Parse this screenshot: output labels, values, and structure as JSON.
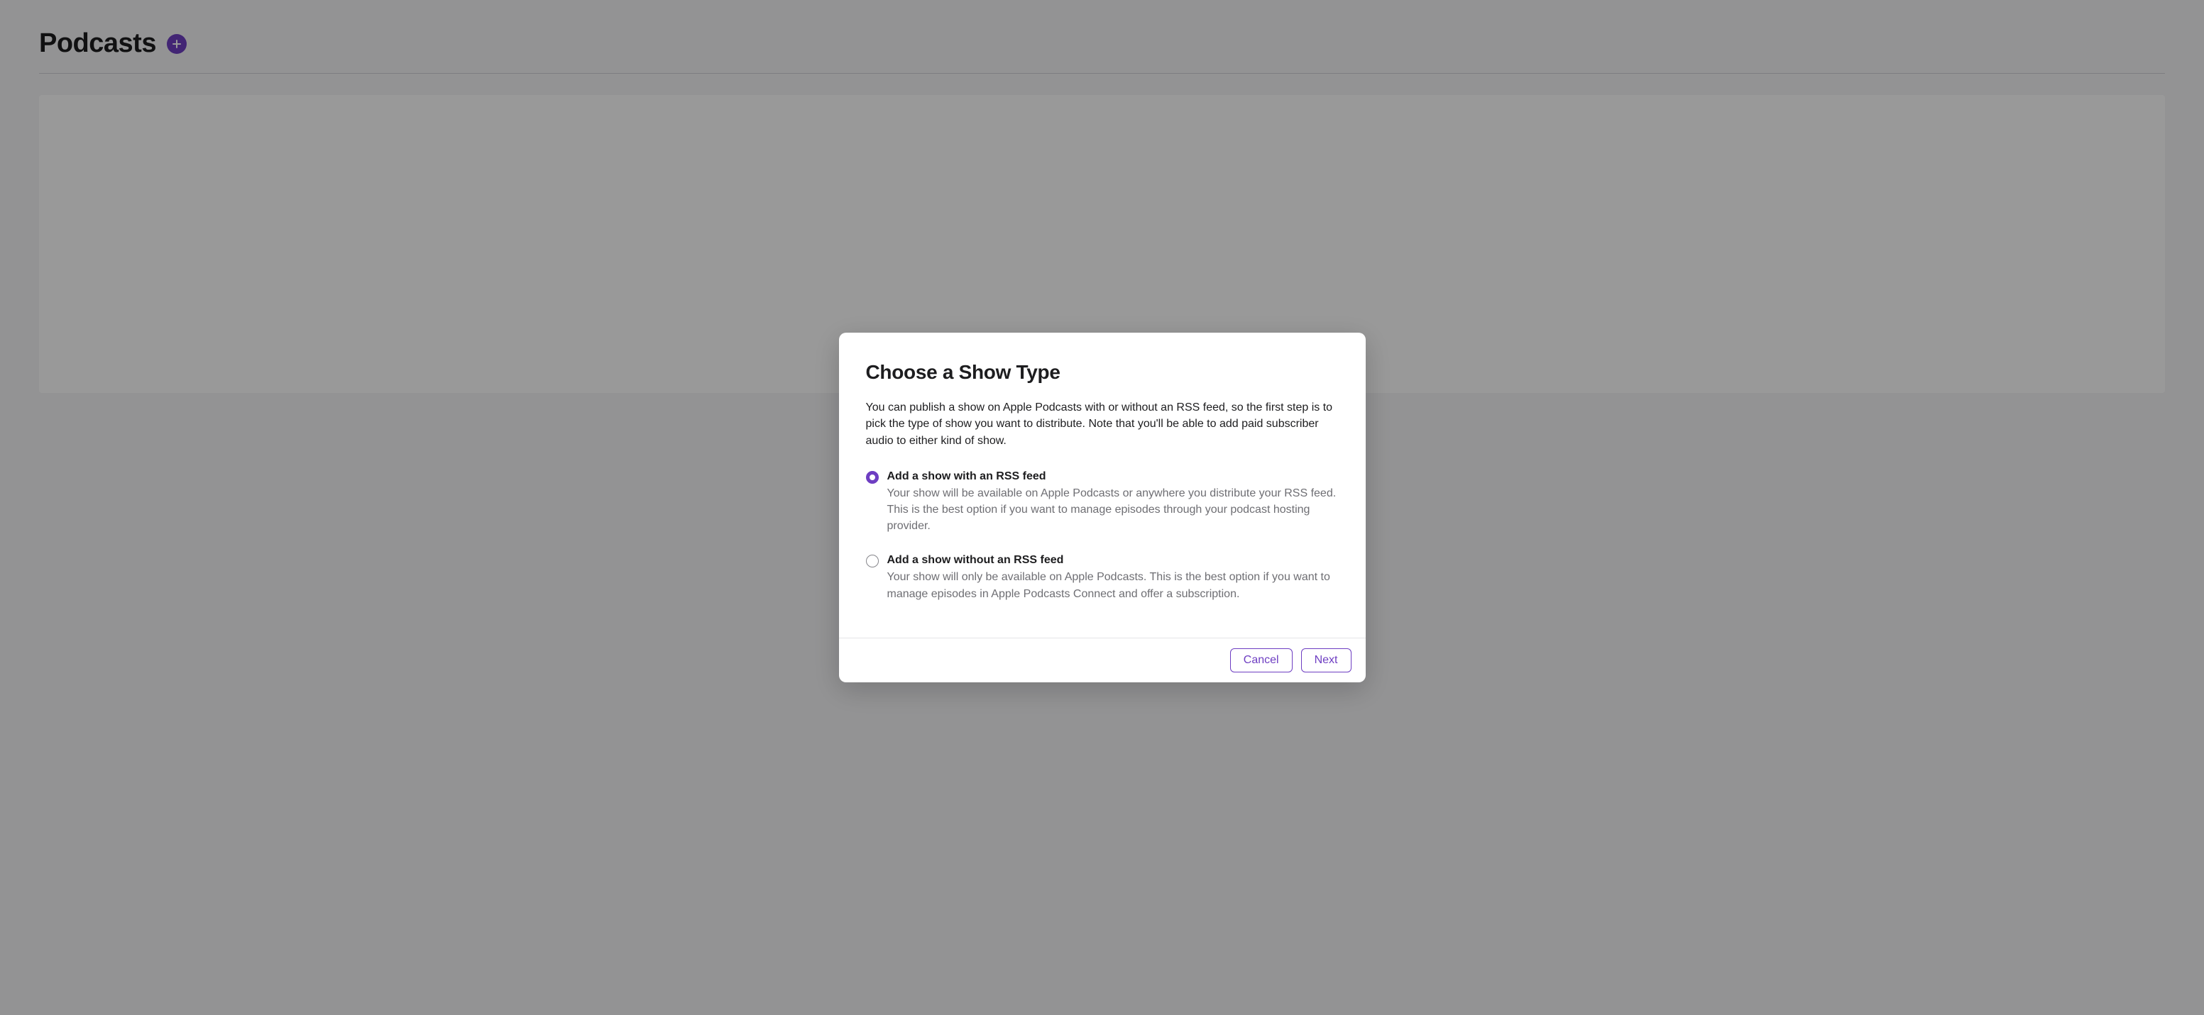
{
  "page": {
    "title": "Podcasts"
  },
  "modal": {
    "title": "Choose a Show Type",
    "description": "You can publish a show on Apple Podcasts with or without an RSS feed, so the first step is to pick the type of show you want to distribute. Note that you'll be able to add paid subscriber audio to either kind of show.",
    "options": [
      {
        "label": "Add a show with an RSS feed",
        "description": "Your show will be available on Apple Podcasts or anywhere you distribute your RSS feed. This is the best option if you want to manage episodes through your podcast hosting provider.",
        "selected": true
      },
      {
        "label": "Add a show without an RSS feed",
        "description": "Your show will only be available on Apple Podcasts. This is the best option if you want to manage episodes in Apple Podcasts Connect and offer a subscription.",
        "selected": false
      }
    ],
    "buttons": {
      "cancel": "Cancel",
      "next": "Next"
    }
  },
  "colors": {
    "accent": "#6e3ec2"
  }
}
